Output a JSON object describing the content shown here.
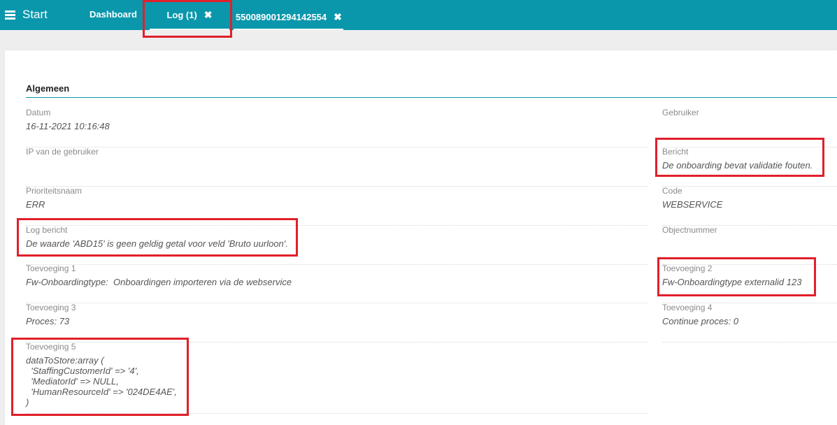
{
  "topbar": {
    "menu_label": "Start",
    "tabs": [
      {
        "label": "Dashboard"
      },
      {
        "label": "Log (1)",
        "close": "✖"
      },
      {
        "label": "550089001294142554",
        "close": "✖"
      }
    ],
    "bg_color": "#0a97ac"
  },
  "section": {
    "title": "Algemeen"
  },
  "fields": {
    "datum": {
      "label": "Datum",
      "value": "16-11-2021 10:16:48"
    },
    "gebruiker": {
      "label": "Gebruiker",
      "value": ""
    },
    "ip": {
      "label": "IP van de gebruiker",
      "value": ""
    },
    "bericht": {
      "label": "Bericht",
      "value": "De onboarding bevat validatie fouten."
    },
    "prioriteit": {
      "label": "Prioriteitsnaam",
      "value": "ERR"
    },
    "code": {
      "label": "Code",
      "value": "WEBSERVICE"
    },
    "log_bericht": {
      "label": "Log bericht",
      "value": "De waarde 'ABD15' is geen geldig getal voor veld 'Bruto uurloon'."
    },
    "objectnummer": {
      "label": "Objectnummer",
      "value": ""
    },
    "toevoeging1": {
      "label": "Toevoeging 1",
      "value": "Fw-Onboardingtype:  Onboardingen importeren via de webservice"
    },
    "toevoeging2": {
      "label": "Toevoeging 2",
      "value": "Fw-Onboardingtype externalid 123"
    },
    "toevoeging3": {
      "label": "Toevoeging 3",
      "value": "Proces: 73"
    },
    "toevoeging4": {
      "label": "Toevoeging 4",
      "value": "Continue proces: 0"
    },
    "toevoeging5": {
      "label": "Toevoeging 5",
      "value": "dataToStore:array (\n  'StaffingCustomerId' => '4',\n  'MediatorId' => NULL,\n  'HumanResourceId' => '024DE4AE',\n)"
    }
  },
  "highlight_color": "#e0202a"
}
